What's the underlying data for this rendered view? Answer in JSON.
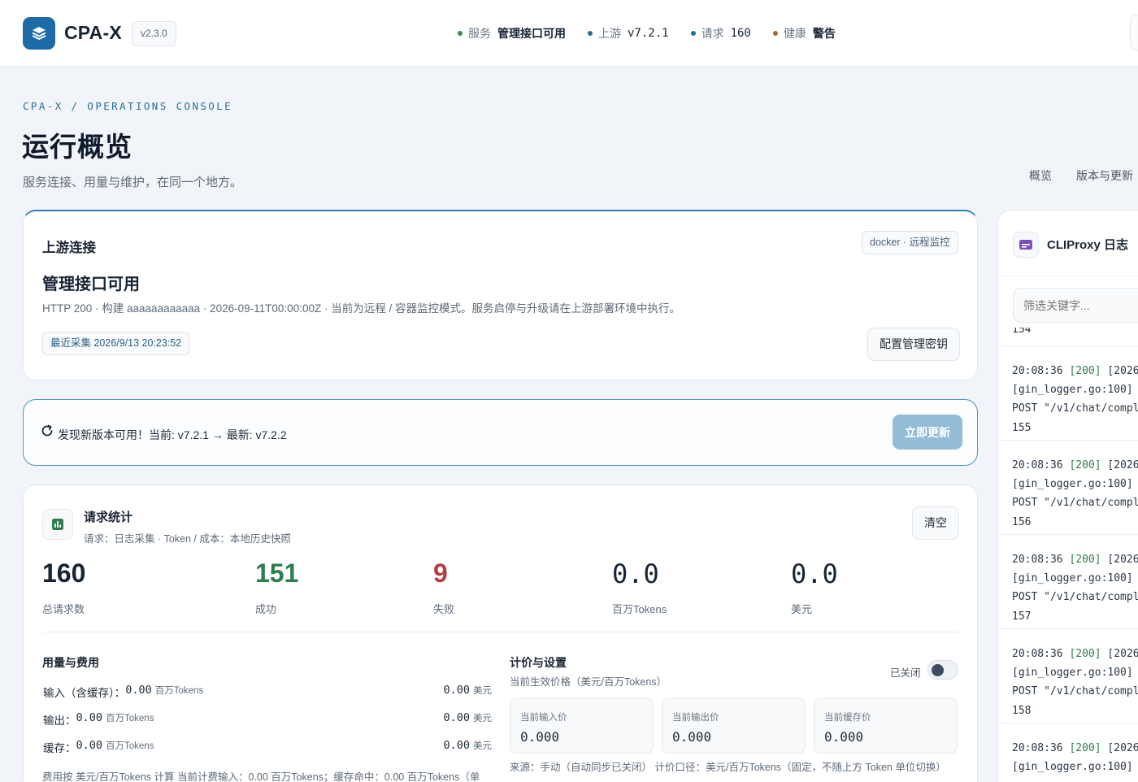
{
  "app": {
    "name": "CPA-X",
    "version": "v2.3.0"
  },
  "status": [
    {
      "key": "服务",
      "value": "管理接口可用",
      "color": "#2f8f5b",
      "mono": false
    },
    {
      "key": "上游",
      "value": "v7.2.1",
      "color": "#2b6f98",
      "mono": true
    },
    {
      "key": "请求",
      "value": "160",
      "color": "#2b6f98",
      "mono": true
    },
    {
      "key": "健康",
      "value": "警告",
      "color": "#b5651d",
      "mono": false
    }
  ],
  "header": {
    "breadcrumb": "CPA-X / OPERATIONS CONSOLE",
    "title": "运行概览",
    "subtitle": "服务连接、用量与维护，在同一个地方。",
    "nav": [
      "概览",
      "版本与更新"
    ]
  },
  "upstream": {
    "heading": "上游连接",
    "mode_tag": "docker · 远程监控",
    "status_title": "管理接口可用",
    "detail": "HTTP 200 · 构建 aaaaaaaaaaaa · 2026-09-11T00:00:00Z · 当前为远程 / 容器监控模式。服务启停与升级请在上游部署环境中执行。",
    "last_collected": "最近采集 2026/9/13 20:23:52",
    "config_button": "配置管理密钥"
  },
  "update": {
    "message": "发现新版本可用！当前: v7.2.1 → 最新: v7.2.2",
    "button": "立即更新"
  },
  "stats": {
    "heading": "请求统计",
    "source": "请求：日志采集 · Token / 成本：本地历史快照",
    "clear_button": "清空",
    "metrics": [
      {
        "value": "160",
        "label": "总请求数",
        "color": "#172433",
        "mono": false
      },
      {
        "value": "151",
        "label": "成功",
        "color": "#2e7d4f",
        "mono": false
      },
      {
        "value": "9",
        "label": "失败",
        "color": "#b83c46",
        "mono": false
      },
      {
        "value": "0.0",
        "label": "百万Tokens",
        "color": "#172433",
        "mono": true
      },
      {
        "value": "0.0",
        "label": "美元",
        "color": "#172433",
        "mono": true
      }
    ],
    "usage": {
      "heading": "用量与费用",
      "rows": [
        {
          "label": "输入（含缓存）：",
          "value": "0.00",
          "unit": "百万Tokens",
          "cost": "0.00",
          "cost_unit": "美元"
        },
        {
          "label": "输出：",
          "value": "0.00",
          "unit": "百万Tokens",
          "cost": "0.00",
          "cost_unit": "美元"
        },
        {
          "label": "缓存：",
          "value": "0.00",
          "unit": "百万Tokens",
          "cost": "0.00",
          "cost_unit": "美元"
        }
      ],
      "note": "费用按 美元/百万Tokens 计算 当前计费输入：0.00 百万Tokens；缓存命中：0.00 百万Tokens（单"
    },
    "pricing": {
      "heading": "计价与设置",
      "subheading": "当前生效价格（美元/百万Tokens）",
      "toggle_label": "已关闭",
      "toggle_on": false,
      "boxes": [
        {
          "label": "当前输入价",
          "value": "0.000"
        },
        {
          "label": "当前输出价",
          "value": "0.000"
        },
        {
          "label": "当前缓存价",
          "value": "0.000"
        }
      ],
      "source_note": "来源：手动（自动同步已关闭） 计价口径：美元/百万Tokens（固定，不随上方 Token 单位切换）"
    }
  },
  "logs": {
    "heading": "CLIProxy 日志",
    "filter_placeholder": "筛选关键字...",
    "partial_top": "154",
    "entries": [
      {
        "time": "20:08:36",
        "code": "[200]",
        "tail": "[2026-",
        "line2": "[gin_logger.go:100] 2",
        "line3": "POST \"/v1/chat/comple",
        "line4": "155"
      },
      {
        "time": "20:08:36",
        "code": "[200]",
        "tail": "[2026-",
        "line2": "[gin_logger.go:100] 2",
        "line3": "POST \"/v1/chat/comple",
        "line4": "156"
      },
      {
        "time": "20:08:36",
        "code": "[200]",
        "tail": "[2026-",
        "line2": "[gin_logger.go:100] 2",
        "line3": "POST \"/v1/chat/comple",
        "line4": "157"
      },
      {
        "time": "20:08:36",
        "code": "[200]",
        "tail": "[2026-",
        "line2": "[gin_logger.go:100] 2",
        "line3": "POST \"/v1/chat/comple",
        "line4": "158"
      },
      {
        "time": "20:08:36",
        "code": "[200]",
        "tail": "[2026-",
        "line2": "[gin_logger.go:100] 2",
        "line3": "",
        "line4": ""
      }
    ]
  }
}
